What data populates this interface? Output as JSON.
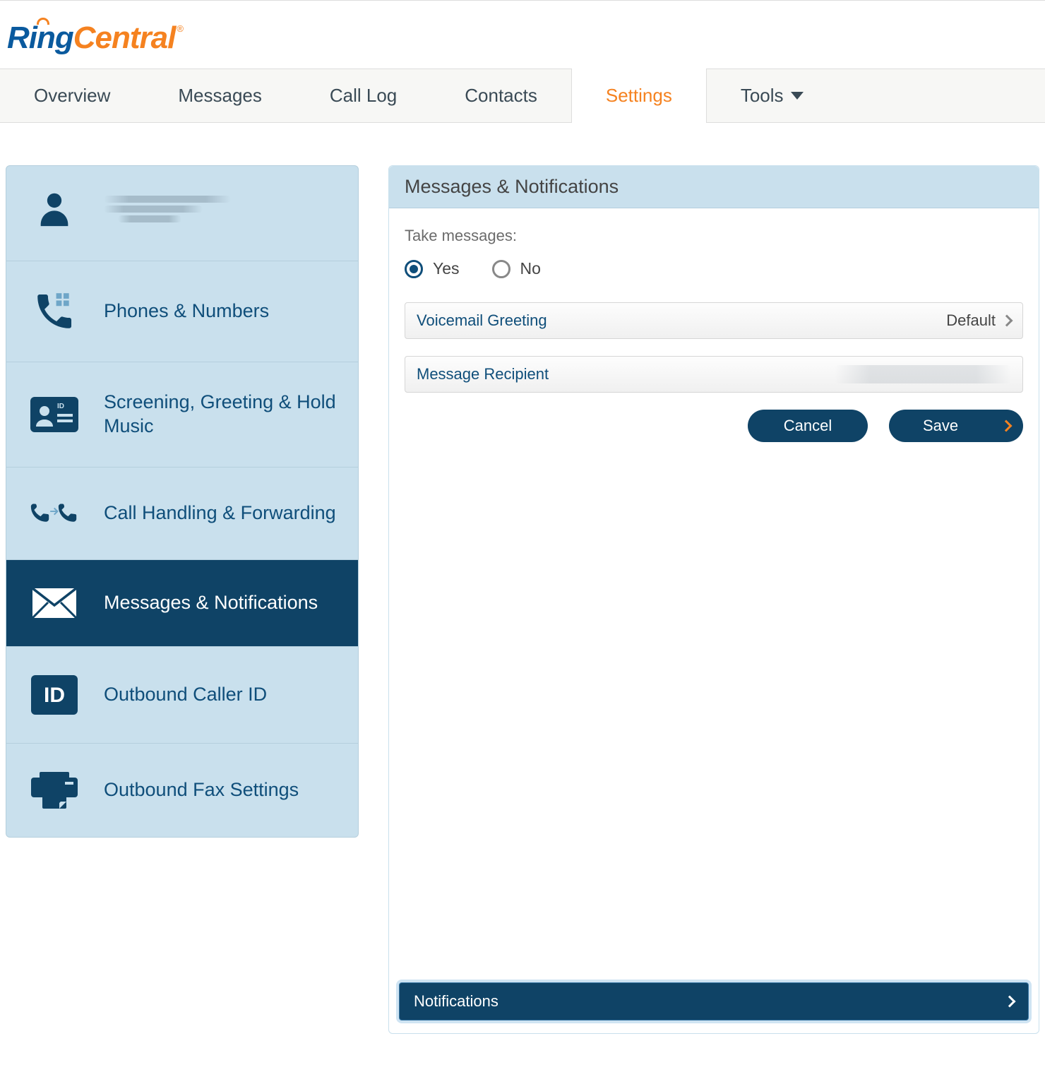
{
  "brand": {
    "part1": "Ring",
    "part2": "Central"
  },
  "tabs": {
    "overview": "Overview",
    "messages": "Messages",
    "calllog": "Call Log",
    "contacts": "Contacts",
    "settings": "Settings",
    "tools": "Tools"
  },
  "sidebar": {
    "phones": "Phones & Numbers",
    "screening": "Screening, Greeting & Hold Music",
    "handling": "Call Handling & Forwarding",
    "messages": "Messages & Notifications",
    "callerid": "Outbound Caller ID",
    "fax": "Outbound Fax Settings"
  },
  "panel": {
    "title": "Messages & Notifications",
    "take_messages_label": "Take messages:",
    "yes": "Yes",
    "no": "No",
    "voicemail_greeting": "Voicemail Greeting",
    "voicemail_value": "Default",
    "message_recipient": "Message Recipient",
    "cancel": "Cancel",
    "save": "Save",
    "notifications": "Notifications"
  }
}
